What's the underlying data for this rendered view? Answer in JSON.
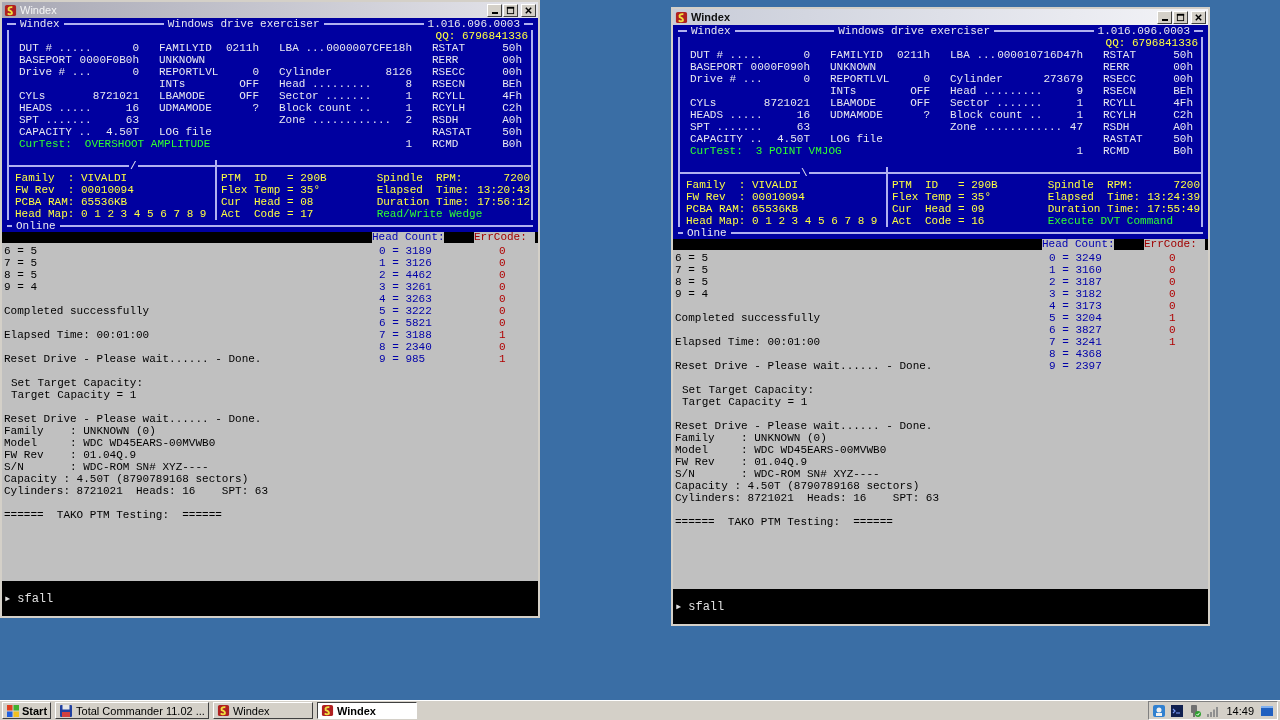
{
  "windows": [
    {
      "title": "Windex",
      "active": false,
      "panel": {
        "app_name": "Windex",
        "subtitle": "Windows drive exerciser",
        "version": "1.016.096.0003",
        "qq": "QQ: 6796841336",
        "rows": [
          {
            "drive": {
              "label": "DUT # .....",
              "value": "0"
            },
            "family": {
              "label": "FAMILYID",
              "value": "0211h"
            },
            "position": {
              "label": "LBA ...",
              "value": "0000007CFE18h"
            },
            "register": {
              "label": "RSTAT",
              "value": "50h"
            }
          },
          {
            "drive": {
              "label": "BASEPORT",
              "value": "0000F0B0h"
            },
            "family": {
              "label": "UNKNOWN"
            },
            "register": {
              "label": "RERR",
              "value": "00h"
            }
          },
          {
            "drive": {
              "label": "Drive # ...",
              "value": "0"
            },
            "family": {
              "label": "REPORTLVL",
              "value": "0"
            },
            "position": {
              "label": "Cylinder",
              "value": "8126"
            },
            "register": {
              "label": "RSECC",
              "value": "00h"
            }
          },
          {
            "family": {
              "label": "INTs",
              "value": "OFF"
            },
            "position": {
              "label": "Head .........",
              "value": "8"
            },
            "register": {
              "label": "RSECN",
              "value": "BEh"
            }
          },
          {
            "drive": {
              "label": "CYLs",
              "value": "8721021"
            },
            "family": {
              "label": "LBAMODE",
              "value": "OFF"
            },
            "position": {
              "label": "Sector .......",
              "value": "1"
            },
            "register": {
              "label": "RCYLL",
              "value": "4Fh"
            }
          },
          {
            "drive": {
              "label": "HEADS .....",
              "value": "16"
            },
            "family": {
              "label": "UDMAMODE",
              "value": "?"
            },
            "position": {
              "label": "Block count ..",
              "value": "1"
            },
            "register": {
              "label": "RCYLH",
              "value": "C2h"
            }
          },
          {
            "drive": {
              "label": "SPT .......",
              "value": "63"
            },
            "position": {
              "label": "Zone ............",
              "value": "2"
            },
            "register": {
              "label": "RSDH",
              "value": "A0h"
            }
          },
          {
            "drive": {
              "label": "CAPACITY ..",
              "value": "4.50T"
            },
            "family": {
              "label": "LOG file"
            },
            "register": {
              "label": "RASTAT",
              "value": "50h"
            }
          },
          {
            "test": {
              "label": "CurTest:",
              "value": "OVERSHOOT AMPLITUDE"
            },
            "position": {
              "value": "1"
            },
            "register": {
              "label": "RCMD",
              "value": "B0h"
            }
          }
        ],
        "spinner": "/",
        "device_info": [
          "Family  : VIVALDI",
          "FW Rev  : 00010094",
          "PCBA RAM: 65536KB",
          "Head Map: 0 1 2 3 4 5 6 7 8 9"
        ],
        "ptm": [
          "PTM  ID   = 290B",
          "Flex Temp = 35°",
          "Cur  Head = 08",
          "Act  Code = 17"
        ],
        "timers": [
          {
            "label": "Spindle  RPM:",
            "value": "7200"
          },
          {
            "label": "Elapsed  Time:",
            "value": "13:20:43"
          },
          {
            "label": "Duration Time:",
            "value": "17:56:12"
          }
        ],
        "status": "Read/Write Wedge",
        "connection": "Online"
      },
      "columns": {
        "head_count": "Head Count:",
        "err_code": "ErrCode:"
      },
      "log_blocks": [
        {
          "indented": false,
          "lines": [
            "6 = 5",
            "7 = 5",
            "8 = 5",
            "9 = 4"
          ]
        },
        {
          "indented": false,
          "lines": [
            "Completed successfully"
          ]
        },
        {
          "indented": false,
          "lines": [
            "Elapsed Time: 00:01:00"
          ]
        },
        {
          "indented": false,
          "lines": [
            "Reset Drive - Please wait...... - Done."
          ]
        },
        {
          "indented": true,
          "lines": [
            "Set Target Capacity:",
            "Target Capacity = 1"
          ]
        },
        {
          "indented": false,
          "lines": [
            "Reset Drive - Please wait...... - Done.",
            "Family    : UNKNOWN (0)",
            "Model     : WDC WD45EARS-00MVWB0",
            "FW Rev    : 01.04Q.9",
            "S/N       : WDC-ROM SN# XYZ----",
            "Capacity : 4.50T (8790789168 sectors)",
            "Cylinders: 8721021  Heads: 16    SPT: 63"
          ]
        },
        {
          "indented": false,
          "lines": [
            "======  TAKO PTM Testing:  ======"
          ]
        }
      ],
      "heads": [
        {
          "entry": "0 = 3189",
          "err": "0"
        },
        {
          "entry": "1 = 3126",
          "err": "0"
        },
        {
          "entry": "2 = 4462",
          "err": "0"
        },
        {
          "entry": "3 = 3261",
          "err": "0"
        },
        {
          "entry": "4 = 3263",
          "err": "0"
        },
        {
          "entry": "5 = 3222",
          "err": "0"
        },
        {
          "entry": "6 = 5821",
          "err": "0"
        },
        {
          "entry": "7 = 3188",
          "err": "1"
        },
        {
          "entry": "8 = 2340",
          "err": "0"
        },
        {
          "entry": "9 = 985",
          "err": "1"
        }
      ],
      "command": {
        "prompt": "▸",
        "text": "sfall"
      }
    },
    {
      "title": "Windex",
      "active": true,
      "panel": {
        "app_name": "Windex",
        "subtitle": "Windows drive exerciser",
        "version": "1.016.096.0003",
        "qq": "QQ: 6796841336",
        "rows": [
          {
            "drive": {
              "label": "DUT # .....",
              "value": "0"
            },
            "family": {
              "label": "FAMILYID",
              "value": "0211h"
            },
            "position": {
              "label": "LBA ...",
              "value": "000010716D47h"
            },
            "register": {
              "label": "RSTAT",
              "value": "50h"
            }
          },
          {
            "drive": {
              "label": "BASEPORT",
              "value": "0000F090h"
            },
            "family": {
              "label": "UNKNOWN"
            },
            "register": {
              "label": "RERR",
              "value": "00h"
            }
          },
          {
            "drive": {
              "label": "Drive # ...",
              "value": "0"
            },
            "family": {
              "label": "REPORTLVL",
              "value": "0"
            },
            "position": {
              "label": "Cylinder",
              "value": "273679"
            },
            "register": {
              "label": "RSECC",
              "value": "00h"
            }
          },
          {
            "family": {
              "label": "INTs",
              "value": "OFF"
            },
            "position": {
              "label": "Head .........",
              "value": "9"
            },
            "register": {
              "label": "RSECN",
              "value": "BEh"
            }
          },
          {
            "drive": {
              "label": "CYLs",
              "value": "8721021"
            },
            "family": {
              "label": "LBAMODE",
              "value": "OFF"
            },
            "position": {
              "label": "Sector .......",
              "value": "1"
            },
            "register": {
              "label": "RCYLL",
              "value": "4Fh"
            }
          },
          {
            "drive": {
              "label": "HEADS .....",
              "value": "16"
            },
            "family": {
              "label": "UDMAMODE",
              "value": "?"
            },
            "position": {
              "label": "Block count ..",
              "value": "1"
            },
            "register": {
              "label": "RCYLH",
              "value": "C2h"
            }
          },
          {
            "drive": {
              "label": "SPT .......",
              "value": "63"
            },
            "position": {
              "label": "Zone ............",
              "value": "47"
            },
            "register": {
              "label": "RSDH",
              "value": "A0h"
            }
          },
          {
            "drive": {
              "label": "CAPACITY ..",
              "value": "4.50T"
            },
            "family": {
              "label": "LOG file"
            },
            "register": {
              "label": "RASTAT",
              "value": "50h"
            }
          },
          {
            "test": {
              "label": "CurTest:",
              "value": "3 POINT VMJOG"
            },
            "position": {
              "value": "1"
            },
            "register": {
              "label": "RCMD",
              "value": "B0h"
            }
          }
        ],
        "spinner": "\\",
        "device_info": [
          "Family  : VIVALDI",
          "FW Rev  : 00010094",
          "PCBA RAM: 65536KB",
          "Head Map: 0 1 2 3 4 5 6 7 8 9"
        ],
        "ptm": [
          "PTM  ID   = 290B",
          "Flex Temp = 35°",
          "Cur  Head = 09",
          "Act  Code = 16"
        ],
        "timers": [
          {
            "label": "Spindle  RPM:",
            "value": "7200"
          },
          {
            "label": "Elapsed  Time:",
            "value": "13:24:39"
          },
          {
            "label": "Duration Time:",
            "value": "17:55:49"
          }
        ],
        "status": "Execute DVT Command",
        "connection": "Online"
      },
      "columns": {
        "head_count": "Head Count:",
        "err_code": "ErrCode:"
      },
      "log_blocks": [
        {
          "indented": false,
          "lines": [
            "6 = 5",
            "7 = 5",
            "8 = 5",
            "9 = 4"
          ]
        },
        {
          "indented": false,
          "lines": [
            "Completed successfully"
          ]
        },
        {
          "indented": false,
          "lines": [
            "Elapsed Time: 00:01:00"
          ]
        },
        {
          "indented": false,
          "lines": [
            "Reset Drive - Please wait...... - Done."
          ]
        },
        {
          "indented": true,
          "lines": [
            "Set Target Capacity:",
            "Target Capacity = 1"
          ]
        },
        {
          "indented": false,
          "lines": [
            "Reset Drive - Please wait...... - Done.",
            "Family    : UNKNOWN (0)",
            "Model     : WDC WD45EARS-00MVWB0",
            "FW Rev    : 01.04Q.9",
            "S/N       : WDC-ROM SN# XYZ----",
            "Capacity : 4.50T (8790789168 sectors)",
            "Cylinders: 8721021  Heads: 16    SPT: 63"
          ]
        },
        {
          "indented": false,
          "lines": [
            "======  TAKO PTM Testing:  ======"
          ]
        }
      ],
      "heads": [
        {
          "entry": "0 = 3249",
          "err": "0"
        },
        {
          "entry": "1 = 3160",
          "err": "0"
        },
        {
          "entry": "2 = 3187",
          "err": "0"
        },
        {
          "entry": "3 = 3182",
          "err": "0"
        },
        {
          "entry": "4 = 3173",
          "err": "0"
        },
        {
          "entry": "5 = 3204",
          "err": "1"
        },
        {
          "entry": "6 = 3827",
          "err": "0"
        },
        {
          "entry": "7 = 3241",
          "err": "1"
        },
        {
          "entry": "8 = 4368"
        },
        {
          "entry": "9 = 2397"
        }
      ],
      "command": {
        "prompt": "▸",
        "text": "sfall"
      }
    }
  ],
  "taskbar": {
    "start": "Start",
    "tasks": [
      {
        "label": "Total Commander 11.02 ...",
        "selected": false,
        "kind": "disk"
      },
      {
        "label": "Windex",
        "selected": false,
        "kind": "app"
      },
      {
        "label": "Windex",
        "selected": true,
        "kind": "app"
      }
    ],
    "clock": "14:49"
  }
}
